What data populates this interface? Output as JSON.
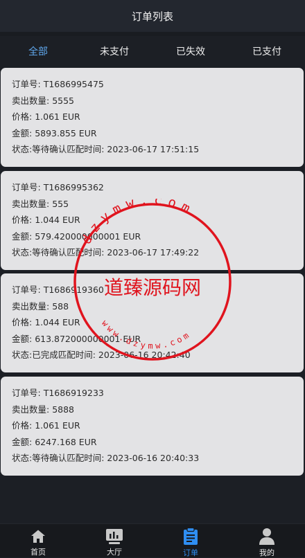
{
  "header": {
    "title": "订单列表"
  },
  "tabs": [
    {
      "label": "全部",
      "active": true
    },
    {
      "label": "未支付",
      "active": false
    },
    {
      "label": "已失效",
      "active": false
    },
    {
      "label": "已支付",
      "active": false
    }
  ],
  "field_labels": {
    "order_no": "订单号: ",
    "sell_qty": "卖出数量: ",
    "price": "价格: ",
    "amount": "金额: ",
    "status": "状态:",
    "match_time": "匹配时间: "
  },
  "orders": [
    {
      "order_no": "T1686995475",
      "sell_qty": "5555",
      "price": "1.061 EUR",
      "amount": "5893.855 EUR",
      "status": "等待确认",
      "match_time": "2023-06-17 17:51:15"
    },
    {
      "order_no": "T1686995362",
      "sell_qty": "555",
      "price": "1.044 EUR",
      "amount": "579.420000000001 EUR",
      "status": "等待确认",
      "match_time": "2023-06-17 17:49:22"
    },
    {
      "order_no": "T1686919360",
      "sell_qty": "588",
      "price": "1.044 EUR",
      "amount": "613.872000000001 EUR",
      "status": "已完成",
      "match_time": "2023-06-16 20:42:40"
    },
    {
      "order_no": "T1686919233",
      "sell_qty": "5888",
      "price": "1.061 EUR",
      "amount": "6247.168 EUR",
      "status": "等待确认",
      "match_time": "2023-06-16 20:40:33"
    }
  ],
  "watermark": {
    "brand": "道臻源码网",
    "url_top": "dzymw.com",
    "url_bottom": "www.dzymw.com"
  },
  "nav": [
    {
      "label": "首页",
      "icon": "home-icon",
      "active": false
    },
    {
      "label": "大厅",
      "icon": "chart-icon",
      "active": false
    },
    {
      "label": "订单",
      "icon": "clipboard-icon",
      "active": true
    },
    {
      "label": "我的",
      "icon": "user-icon",
      "active": false
    }
  ],
  "colors": {
    "accent": "#5fa7ec",
    "nav_active": "#2f8ef2",
    "stamp": "#e0141e"
  }
}
